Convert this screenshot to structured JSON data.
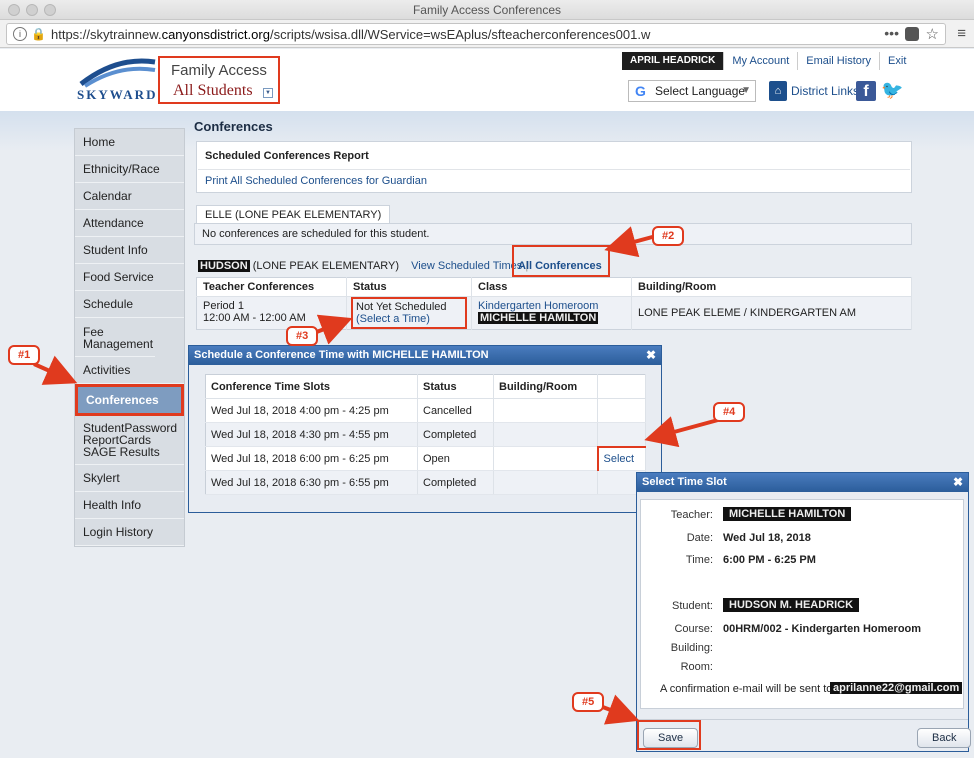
{
  "browser": {
    "window_title": "Family Access Conferences",
    "url_prefix": "https://skytrainnew.",
    "url_domain": "canyonsdistrict.org",
    "url_path": "/scripts/wsisa.dll/WService=wsEAplus/sfteacherconferences001.w",
    "menu_glyph": "≡"
  },
  "header": {
    "logo_text": "SKYWARD",
    "family_access": "Family Access",
    "student_selector": "All Students",
    "user_name": "APRIL HEADRICK",
    "links": [
      "My Account",
      "Email History",
      "Exit"
    ],
    "translate_label": "Select Language",
    "district_links": "District Links"
  },
  "sidebar": {
    "items": [
      "Home",
      "Ethnicity/Race",
      "Calendar",
      "Attendance",
      "Student Info",
      "Food Service",
      "Schedule",
      "Fee Management",
      "Activities",
      "Conferences",
      "StudentPassword ReportCards SAGE Results",
      "Skylert",
      "Health Info",
      "Login History"
    ],
    "active": "Conferences"
  },
  "main": {
    "title": "Conferences",
    "report_heading": "Scheduled Conferences Report",
    "report_link": "Print All Scheduled Conferences for Guardian",
    "elle_tab": "ELLE (LONE PEAK ELEMENTARY)",
    "elle_message": "No conferences are scheduled for this student.",
    "hudson_name": "HUDSON",
    "hudson_school": " (LONE PEAK ELEMENTARY)",
    "view_scheduled": "View Scheduled Times",
    "all_conferences": "All Conferences",
    "table_headers": [
      "Teacher Conferences",
      "Status",
      "Class",
      "Building/Room"
    ],
    "row": {
      "period": "Period 1",
      "time": "12:00 AM - 12:00 AM",
      "status": "Not Yet Scheduled",
      "select_time": "(Select a Time)",
      "class": "Kindergarten Homeroom",
      "teacher": "MICHELLE HAMILTON",
      "building": "LONE PEAK ELEME / KINDERGARTEN AM"
    }
  },
  "dialog1": {
    "title": "Schedule a Conference Time with MICHELLE HAMILTON",
    "headers": [
      "Conference Time Slots",
      "Status",
      "Building/Room",
      ""
    ],
    "slots": [
      {
        "time": "Wed Jul 18, 2018 4:00 pm - 4:25 pm",
        "status": "Cancelled",
        "room": "",
        "action": ""
      },
      {
        "time": "Wed Jul 18, 2018 4:30 pm - 4:55 pm",
        "status": "Completed",
        "room": "",
        "action": ""
      },
      {
        "time": "Wed Jul 18, 2018 6:00 pm - 6:25 pm",
        "status": "Open",
        "room": "",
        "action": "Select"
      },
      {
        "time": "Wed Jul 18, 2018 6:30 pm - 6:55 pm",
        "status": "Completed",
        "room": "",
        "action": ""
      }
    ]
  },
  "dialog2": {
    "title": "Select Time Slot",
    "labels": {
      "teacher": "Teacher:",
      "date": "Date:",
      "time": "Time:",
      "student": "Student:",
      "course": "Course:",
      "building": "Building:",
      "room": "Room:"
    },
    "values": {
      "teacher": "MICHELLE HAMILTON",
      "date": "Wed Jul 18, 2018",
      "time": "6:00 PM - 6:25 PM",
      "student": "HUDSON M. HEADRICK",
      "course": "00HRM/002 - Kindergarten Homeroom"
    },
    "confirm_text": "A confirmation e-mail will be sent to:",
    "email": "aprilanne22@gmail.com",
    "save": "Save",
    "back": "Back"
  },
  "annotations": [
    "#1",
    "#2",
    "#3",
    "#4",
    "#5"
  ],
  "colors": {
    "annotation": "#e03a1e",
    "dialog_header": "#2b5d9a",
    "link": "#1d4f8c"
  }
}
